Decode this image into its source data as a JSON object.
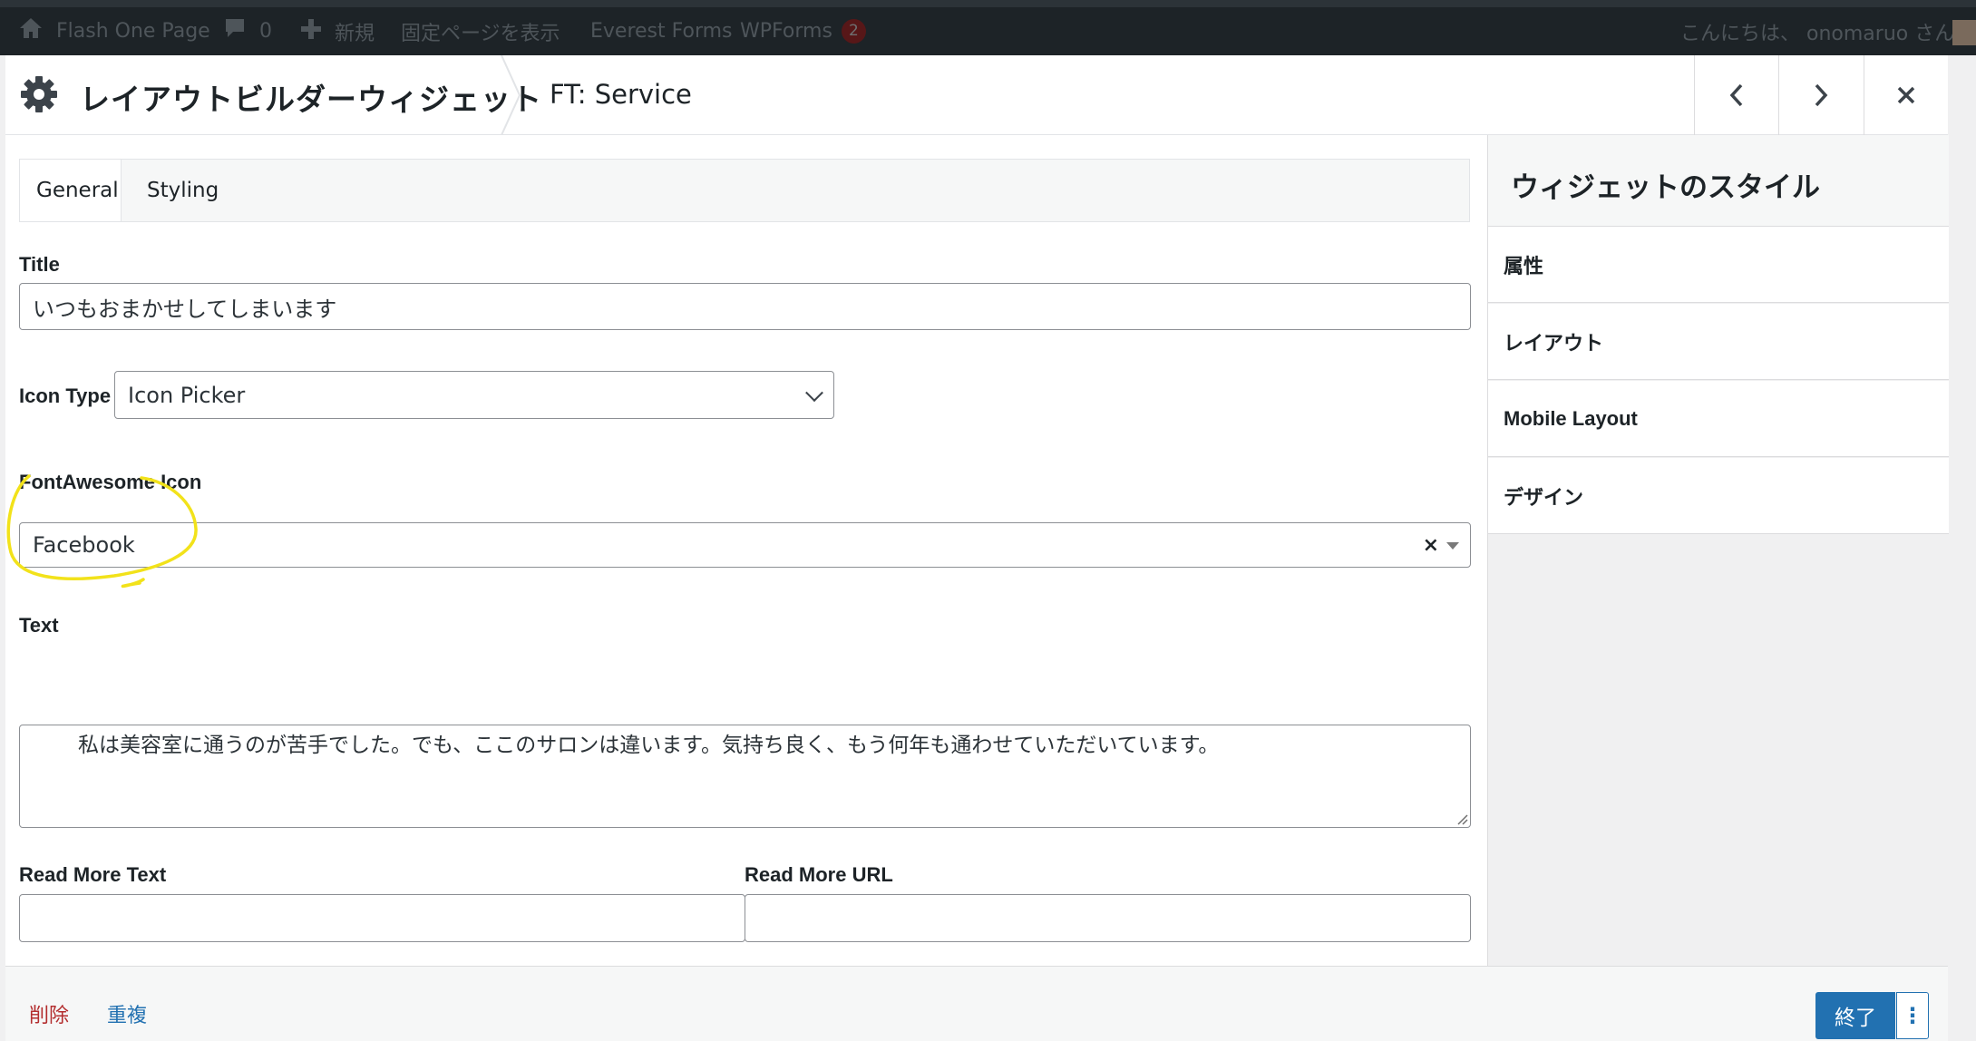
{
  "admin_bar": {
    "site_name": "Flash One Page",
    "comments_count": "0",
    "new_label": "新規",
    "view_page": "固定ページを表示",
    "everest_forms": "Everest Forms",
    "wpforms": "WPForms",
    "wpforms_badge": "2",
    "greeting": "こんにちは、 onomaruo さん"
  },
  "dialog": {
    "title": "レイアウトビルダーウィジェット",
    "subtitle": "FT: Service",
    "prev_icon": "chevron-left-icon",
    "next_icon": "chevron-right-icon",
    "close_icon": "close-icon"
  },
  "tabs": [
    {
      "label": "General",
      "active": true
    },
    {
      "label": "Styling",
      "active": false
    }
  ],
  "form": {
    "title_label": "Title",
    "title_value": "いつもおまかせしてしまいます",
    "icon_type_label": "Icon Type",
    "icon_type_value": "Icon Picker",
    "fa_icon_label": "FontAwesome Icon",
    "fa_icon_value": "Facebook",
    "fa_clear": "×",
    "text_label": "Text",
    "text_value": "私は美容室に通うのが苦手でした。でも、ここのサロンは違います。気持ち良く、もう何年も通わせていただいています。",
    "read_more_text_label": "Read More Text",
    "read_more_text_value": "",
    "read_more_url_label": "Read More URL",
    "read_more_url_value": ""
  },
  "sidebar": {
    "title": "ウィジェットのスタイル",
    "items": [
      "属性",
      "レイアウト",
      "Mobile Layout",
      "デザイン"
    ]
  },
  "footer": {
    "delete": "削除",
    "duplicate": "重複",
    "done": "終了",
    "more": "⋮"
  },
  "colors": {
    "accent": "#2271b1",
    "danger": "#b32d2e",
    "annotation": "#f2e21a"
  }
}
